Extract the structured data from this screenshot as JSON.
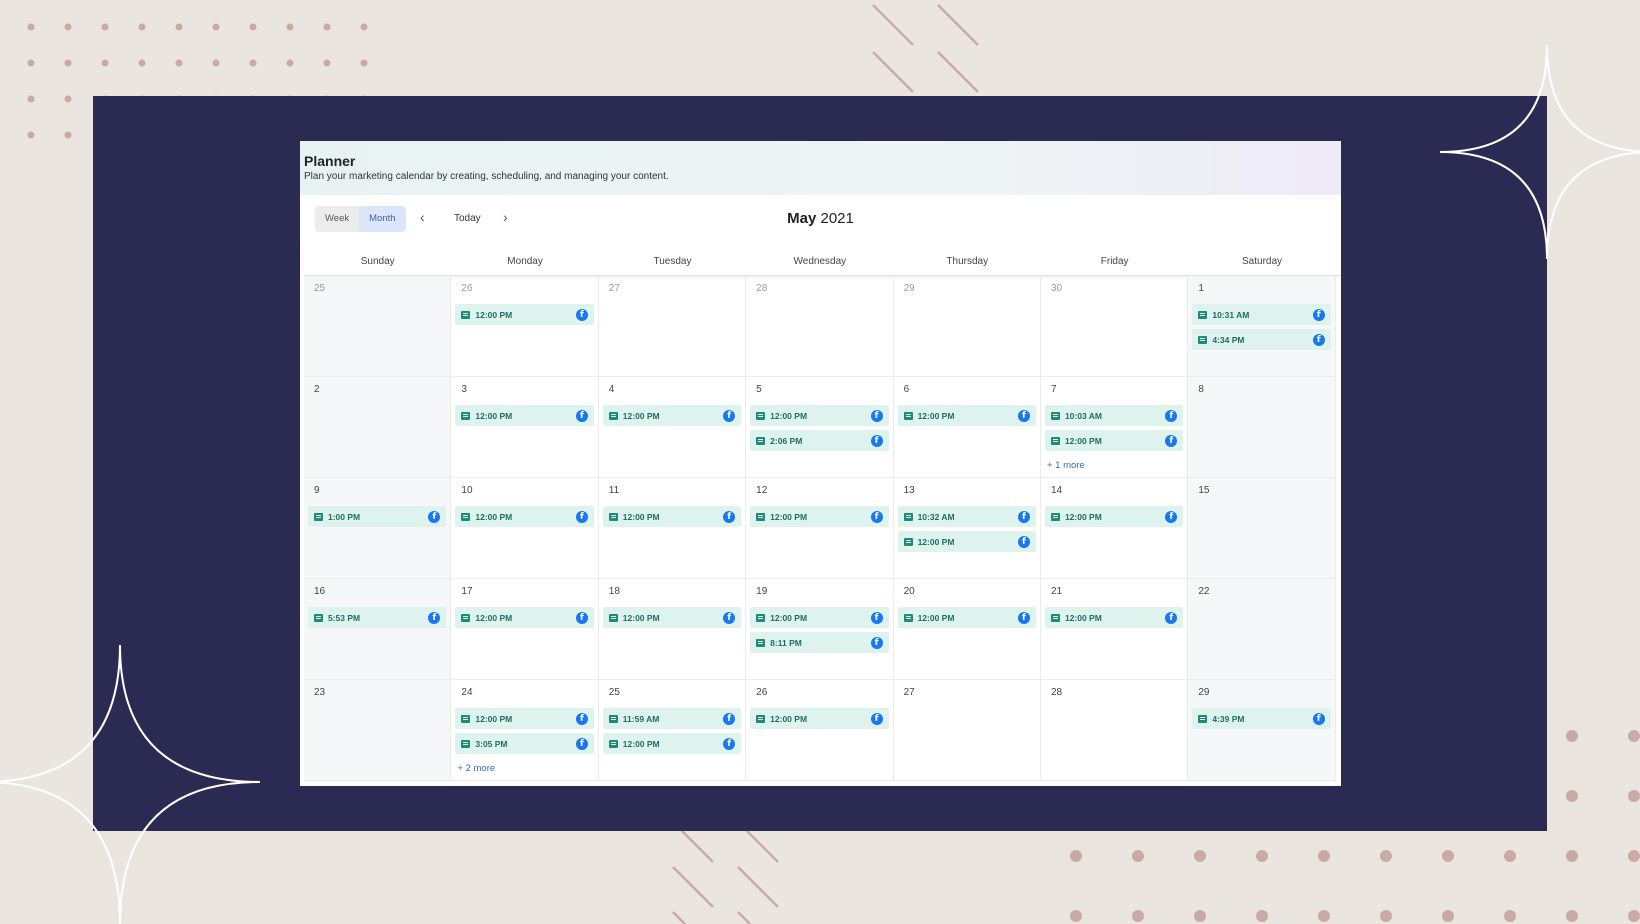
{
  "app": {
    "title": "Planner",
    "subtitle": "Plan your marketing calendar by creating, scheduling, and managing your content."
  },
  "toolbar": {
    "week_label": "Week",
    "month_label": "Month",
    "active_view": "Month",
    "today_label": "Today",
    "prev_icon": "chevron-left-icon",
    "next_icon": "chevron-right-icon",
    "month": "May",
    "year": "2021"
  },
  "weekdays": [
    "Sunday",
    "Monday",
    "Tuesday",
    "Wednesday",
    "Thursday",
    "Friday",
    "Saturday"
  ],
  "colors": {
    "frame": "#2b2a52",
    "background": "#ebe5df",
    "event_bg": "#dff3ee",
    "event_text": "#1d6e62",
    "facebook": "#1877f2",
    "more_link": "#2f6fbf"
  },
  "weeks": [
    [
      {
        "day": "25",
        "muted": true,
        "events": []
      },
      {
        "day": "26",
        "muted": true,
        "events": [
          "12:00 PM"
        ]
      },
      {
        "day": "27",
        "muted": true,
        "events": []
      },
      {
        "day": "28",
        "muted": true,
        "events": []
      },
      {
        "day": "29",
        "muted": true,
        "events": []
      },
      {
        "day": "30",
        "muted": true,
        "events": []
      },
      {
        "day": "1",
        "events": [
          "10:31 AM",
          "4:34 PM"
        ]
      }
    ],
    [
      {
        "day": "2",
        "events": []
      },
      {
        "day": "3",
        "events": [
          "12:00 PM"
        ]
      },
      {
        "day": "4",
        "events": [
          "12:00 PM"
        ]
      },
      {
        "day": "5",
        "events": [
          "12:00 PM",
          "2:06 PM"
        ]
      },
      {
        "day": "6",
        "events": [
          "12:00 PM"
        ]
      },
      {
        "day": "7",
        "events": [
          "10:03 AM",
          "12:00 PM"
        ],
        "more": "+ 1 more"
      },
      {
        "day": "8",
        "events": []
      }
    ],
    [
      {
        "day": "9",
        "events": [
          "1:00 PM"
        ]
      },
      {
        "day": "10",
        "events": [
          "12:00 PM"
        ]
      },
      {
        "day": "11",
        "events": [
          "12:00 PM"
        ]
      },
      {
        "day": "12",
        "events": [
          "12:00 PM"
        ]
      },
      {
        "day": "13",
        "events": [
          "10:32 AM",
          "12:00 PM"
        ]
      },
      {
        "day": "14",
        "events": [
          "12:00 PM"
        ]
      },
      {
        "day": "15",
        "events": []
      }
    ],
    [
      {
        "day": "16",
        "events": [
          "5:53 PM"
        ]
      },
      {
        "day": "17",
        "events": [
          "12:00 PM"
        ]
      },
      {
        "day": "18",
        "events": [
          "12:00 PM"
        ]
      },
      {
        "day": "19",
        "events": [
          "12:00 PM",
          "8:11 PM"
        ]
      },
      {
        "day": "20",
        "events": [
          "12:00 PM"
        ]
      },
      {
        "day": "21",
        "events": [
          "12:00 PM"
        ]
      },
      {
        "day": "22",
        "events": []
      }
    ],
    [
      {
        "day": "23",
        "events": []
      },
      {
        "day": "24",
        "events": [
          "12:00 PM",
          "3:05 PM"
        ],
        "more": "+ 2 more"
      },
      {
        "day": "25",
        "events": [
          "11:59 AM",
          "12:00 PM"
        ]
      },
      {
        "day": "26",
        "events": [
          "12:00 PM"
        ]
      },
      {
        "day": "27",
        "events": []
      },
      {
        "day": "28",
        "events": []
      },
      {
        "day": "29",
        "events": [
          "4:39 PM"
        ]
      }
    ]
  ]
}
